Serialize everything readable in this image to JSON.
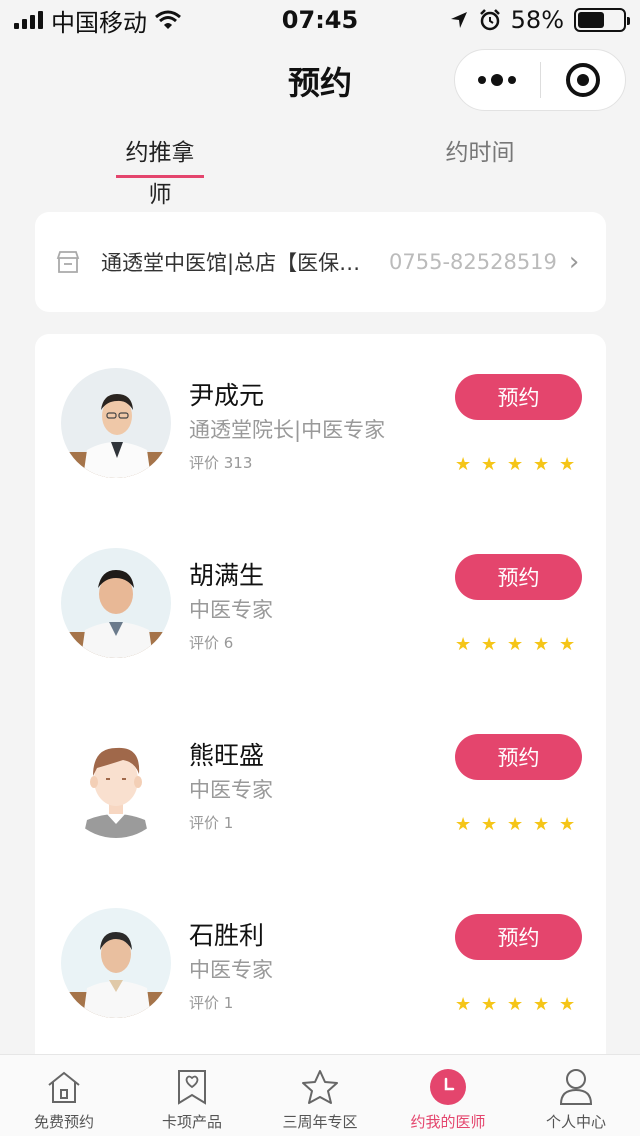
{
  "status_bar": {
    "carrier": "中国移动",
    "time": "07:45",
    "battery": "58%"
  },
  "nav": {
    "title": "预约"
  },
  "tabs": [
    {
      "label": "约推拿师",
      "active": true
    },
    {
      "label": "约时间",
      "active": false
    }
  ],
  "store": {
    "name": "通透堂中医馆|总店【医保定点】",
    "phone": "0755-82528519"
  },
  "doctors": [
    {
      "name": "尹成元",
      "title": "通透堂院长|中医专家",
      "rating": "评价 313",
      "button": "预约",
      "stars": 5
    },
    {
      "name": "胡满生",
      "title": "中医专家",
      "rating": "评价 6",
      "button": "预约",
      "stars": 5
    },
    {
      "name": "熊旺盛",
      "title": "中医专家",
      "rating": "评价 1",
      "button": "预约",
      "stars": 5
    },
    {
      "name": "石胜利",
      "title": "中医专家",
      "rating": "评价 1",
      "button": "预约",
      "stars": 5
    }
  ],
  "tabbar": [
    {
      "label": "免费预约",
      "icon": "house-icon",
      "active": false
    },
    {
      "label": "卡项产品",
      "icon": "bookmark-heart-icon",
      "active": false
    },
    {
      "label": "三周年专区",
      "icon": "star-icon",
      "active": false
    },
    {
      "label": "约我的医师",
      "icon": "clock-icon",
      "active": true
    },
    {
      "label": "个人中心",
      "icon": "person-icon",
      "active": false
    }
  ],
  "colors": {
    "accent": "#e4456d",
    "star": "#f5c518"
  }
}
